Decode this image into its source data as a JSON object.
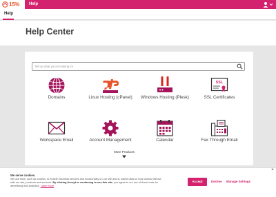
{
  "topbar": {
    "logo_text": "15% off",
    "help_label": "Help",
    "user_icon": "user-icon"
  },
  "subnav": {
    "tab_label": "Help"
  },
  "page": {
    "title": "Help Center"
  },
  "search": {
    "placeholder": "Tell us what you're looking for",
    "icon": "search-icon"
  },
  "products": [
    {
      "label": "Domains",
      "icon": "globe-icon"
    },
    {
      "label": "Linux Hosting (cPanel)",
      "icon": "cpanel-icon"
    },
    {
      "label": "Windows Hosting (Plesk)",
      "icon": "server-icon"
    },
    {
      "label": "SSL Certificates",
      "icon": "ssl-certificate-icon"
    },
    {
      "label": "Workspace Email",
      "icon": "envelope-icon"
    },
    {
      "label": "Account Management",
      "icon": "gear-icon"
    },
    {
      "label": "Calendar",
      "icon": "calendar-icon"
    },
    {
      "label": "Fax Through Email",
      "icon": "fax-icon"
    }
  ],
  "more_products": {
    "label": "More Products",
    "icon": "chevron-down-icon"
  },
  "cookie_banner": {
    "title": "We serve cookies.",
    "text_part1": "We use tools, such as cookies, to enable essential services and functionality on our site and to collect data on how visitors interact with our site, products and services. ",
    "text_bold": "By clicking Accept or continuing to use this site",
    "text_part2": ", you agree to our use of these tools for advertising and analytics. ",
    "learn_more": "Learn More",
    "accept_label": "Accept",
    "decline_label": "Decline",
    "manage_label": "Manage Settings",
    "close_label": "×"
  },
  "colors": {
    "brand": "#d3236f",
    "logo_orange": "#e8542a"
  }
}
